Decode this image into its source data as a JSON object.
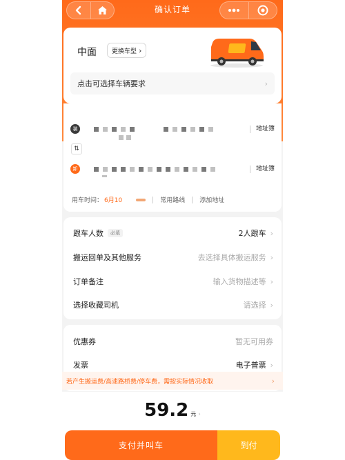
{
  "nav": {
    "title": "确认订单"
  },
  "vehicle": {
    "name": "中面",
    "change_label": "更换车型",
    "requirement_label": "点击可选择车辆要求"
  },
  "address": {
    "load_badge": "装",
    "unload_badge": "卸",
    "addrbook_label": "地址簿",
    "time_label": "用车时间：",
    "time_value": "6月10",
    "common_route": "常用路线",
    "add_address": "添加地址"
  },
  "options": [
    {
      "label": "跟车人数",
      "tag": "必填",
      "value": "2人跟车",
      "placeholder": false
    },
    {
      "label": "搬运回单及其他服务",
      "tag": "",
      "value": "去选择具体搬运服务",
      "placeholder": true
    },
    {
      "label": "订单备注",
      "tag": "",
      "value": "输入货物描述等",
      "placeholder": true
    },
    {
      "label": "选择收藏司机",
      "tag": "",
      "value": "请选择",
      "placeholder": true
    }
  ],
  "coupon": {
    "label": "优惠券",
    "value": "暂无可用券"
  },
  "invoice": {
    "label": "发票",
    "value": "电子普票"
  },
  "notice": "若产生搬运费/高速路桥费/停车费，需按实际情况收取",
  "price": {
    "amount": "59.2",
    "unit": "元"
  },
  "buttons": {
    "pay": "支付并叫车",
    "cod": "到付"
  },
  "colors": {
    "brand": "#ff6a1a",
    "secondary": "#ffb81c"
  }
}
